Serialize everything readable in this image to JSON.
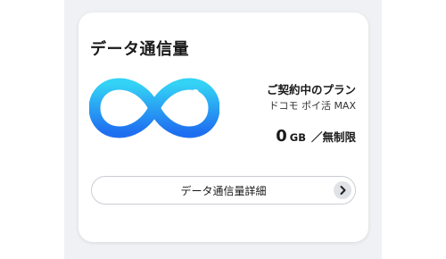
{
  "card": {
    "title": "データ通信量",
    "plan_label": "ご契約中のプラン",
    "plan_name": "ドコモ ポイ活 MAX",
    "usage_value": "0",
    "usage_unit": "GB",
    "usage_limit": "／無制限",
    "detail_button_label": "データ通信量詳細"
  },
  "icons": {
    "logo": "infinity-icon",
    "button": "chevron-right-icon"
  },
  "colors": {
    "page_background": "#f0f1f4",
    "card_background": "#ffffff",
    "logo_gradient_top": "#34d3f5",
    "logo_gradient_bottom": "#1e6ff0",
    "chevron_background": "#dfe2e7"
  }
}
